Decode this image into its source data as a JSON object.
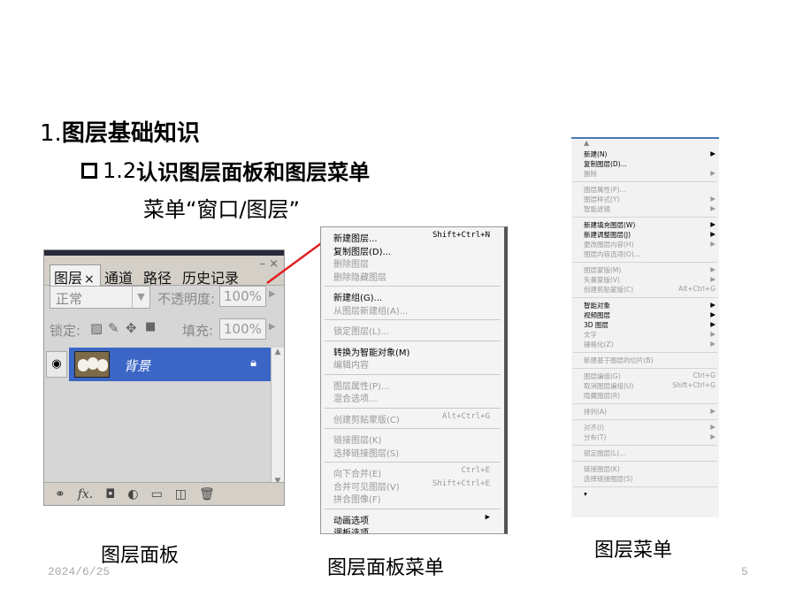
{
  "slide": {
    "title_num": "1.",
    "title": "图层基础知识",
    "subtitle_num": "1.2",
    "subtitle": "认识图层面板和图层菜单",
    "menu_path": "菜单“窗口/图层”",
    "captions": {
      "panel": "图层面板",
      "panel_menu": "图层面板菜单",
      "layer_menu": "图层菜单"
    },
    "date": "2024/6/25",
    "page_number": "5"
  },
  "layers_panel": {
    "tabs": [
      "图层",
      "通道",
      "路径",
      "历史记录"
    ],
    "tab_close": "×",
    "window_controls": "– ×",
    "blend_mode": "正常",
    "opacity_label": "不透明度:",
    "opacity_value": "100%",
    "lock_label": "锁定:",
    "fill_label": "填充:",
    "fill_value": "100%",
    "layer_name": "背景",
    "bottom_icons": [
      "link-icon",
      "fx-icon",
      "mask-icon",
      "adjustment-icon",
      "folder-icon",
      "new-layer-icon",
      "trash-icon"
    ],
    "fx_text": "fx."
  },
  "panel_menu": {
    "items": [
      {
        "label": "新建图层...",
        "shortcut": "Shift+Ctrl+N",
        "disabled": false
      },
      {
        "label": "复制图层(D)...",
        "shortcut": "",
        "disabled": false
      },
      {
        "label": "删除图层",
        "shortcut": "",
        "disabled": true
      },
      {
        "label": "删除隐藏图层",
        "shortcut": "",
        "disabled": true
      },
      {
        "sep": true
      },
      {
        "label": "新建组(G)...",
        "shortcut": "",
        "disabled": false
      },
      {
        "label": "从图层新建组(A)...",
        "shortcut": "",
        "disabled": true
      },
      {
        "sep": true
      },
      {
        "label": "锁定图层(L)...",
        "shortcut": "",
        "disabled": true
      },
      {
        "sep": true
      },
      {
        "label": "转换为智能对象(M)",
        "shortcut": "",
        "disabled": false
      },
      {
        "label": "编辑内容",
        "shortcut": "",
        "disabled": true
      },
      {
        "sep": true
      },
      {
        "label": "图层属性(P)...",
        "shortcut": "",
        "disabled": true
      },
      {
        "label": "混合选项...",
        "shortcut": "",
        "disabled": true
      },
      {
        "sep": true
      },
      {
        "label": "创建剪贴蒙版(C)",
        "shortcut": "Alt+Ctrl+G",
        "disabled": true
      },
      {
        "sep": true
      },
      {
        "label": "链接图层(K)",
        "shortcut": "",
        "disabled": true
      },
      {
        "label": "选择链接图层(S)",
        "shortcut": "",
        "disabled": true
      },
      {
        "sep": true
      },
      {
        "label": "向下合并(E)",
        "shortcut": "Ctrl+E",
        "disabled": true
      },
      {
        "label": "合并可见图层(V)",
        "shortcut": "Shift+Ctrl+E",
        "disabled": true
      },
      {
        "label": "拼合图像(F)",
        "shortcut": "",
        "disabled": true
      },
      {
        "sep": true
      },
      {
        "label": "动画选项",
        "shortcut": "▶",
        "disabled": false
      },
      {
        "label": "调板选项...",
        "shortcut": "",
        "disabled": false
      }
    ]
  },
  "layer_menu": {
    "items": [
      {
        "label": "新建(N)",
        "shortcut": "▶",
        "disabled": false
      },
      {
        "label": "复制图层(D)...",
        "shortcut": "",
        "disabled": false
      },
      {
        "label": "删除",
        "shortcut": "▶",
        "disabled": true
      },
      {
        "sep": true
      },
      {
        "label": "图层属性(P)...",
        "shortcut": "",
        "disabled": true
      },
      {
        "label": "图层样式(Y)",
        "shortcut": "▶",
        "disabled": true
      },
      {
        "label": "智能滤镜",
        "shortcut": "▶",
        "disabled": true
      },
      {
        "sep": true
      },
      {
        "label": "新建填充图层(W)",
        "shortcut": "▶",
        "disabled": false
      },
      {
        "label": "新建调整图层(J)",
        "shortcut": "▶",
        "disabled": false
      },
      {
        "label": "更改图层内容(H)",
        "shortcut": "▶",
        "disabled": true
      },
      {
        "label": "图层内容选项(O)...",
        "shortcut": "",
        "disabled": true
      },
      {
        "sep": true
      },
      {
        "label": "图层蒙版(M)",
        "shortcut": "▶",
        "disabled": true
      },
      {
        "label": "矢量蒙版(V)",
        "shortcut": "▶",
        "disabled": true
      },
      {
        "label": "创建剪贴蒙版(C)",
        "shortcut": "Alt+Ctrl+G",
        "disabled": true
      },
      {
        "sep": true
      },
      {
        "label": "智能对象",
        "shortcut": "▶",
        "disabled": false
      },
      {
        "label": "视频图层",
        "shortcut": "▶",
        "disabled": false
      },
      {
        "label": "3D 图层",
        "shortcut": "▶",
        "disabled": false
      },
      {
        "label": "文字",
        "shortcut": "▶",
        "disabled": true
      },
      {
        "label": "栅格化(Z)",
        "shortcut": "▶",
        "disabled": true
      },
      {
        "sep": true
      },
      {
        "label": "新建基于图层的切片(B)",
        "shortcut": "",
        "disabled": true
      },
      {
        "sep": true
      },
      {
        "label": "图层编组(G)",
        "shortcut": "Ctrl+G",
        "disabled": true
      },
      {
        "label": "取消图层编组(U)",
        "shortcut": "Shift+Ctrl+G",
        "disabled": true
      },
      {
        "label": "隐藏图层(R)",
        "shortcut": "",
        "disabled": true
      },
      {
        "sep": true
      },
      {
        "label": "排列(A)",
        "shortcut": "▶",
        "disabled": true
      },
      {
        "sep": true
      },
      {
        "label": "对齐(I)",
        "shortcut": "▶",
        "disabled": true
      },
      {
        "label": "分布(T)",
        "shortcut": "▶",
        "disabled": true
      },
      {
        "sep": true
      },
      {
        "label": "锁定图层(L)...",
        "shortcut": "",
        "disabled": true
      },
      {
        "sep": true
      },
      {
        "label": "链接图层(K)",
        "shortcut": "",
        "disabled": true
      },
      {
        "label": "选择链接图层(S)",
        "shortcut": "",
        "disabled": true
      },
      {
        "sep": true
      },
      {
        "label": "▾",
        "shortcut": "",
        "disabled": false
      }
    ]
  },
  "colors": {
    "selected_layer": "#3b66c6",
    "arrow": "#e02020",
    "menu_accent": "#4a78b8"
  }
}
